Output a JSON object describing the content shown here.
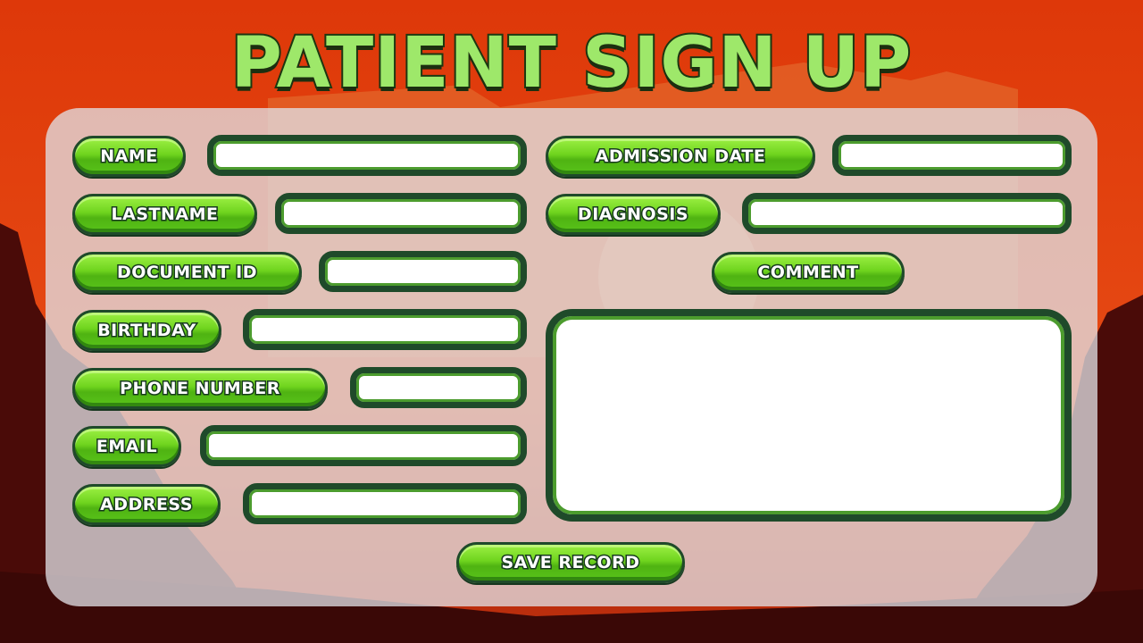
{
  "title": "PATIENT SIGN UP",
  "colors": {
    "sky": "#dd3a0c",
    "panel": "#e1e1e6",
    "button_green": "#6fd41e",
    "button_border": "#1f4a2a",
    "title_green": "#9ee86a"
  },
  "form": {
    "left_fields": [
      {
        "label": "NAME",
        "value": "",
        "placeholder": ""
      },
      {
        "label": "LASTNAME",
        "value": "",
        "placeholder": ""
      },
      {
        "label": "DOCUMENT ID",
        "value": "",
        "placeholder": ""
      },
      {
        "label": "BIRTHDAY",
        "value": "",
        "placeholder": ""
      },
      {
        "label": "PHONE NUMBER",
        "value": "",
        "placeholder": ""
      },
      {
        "label": "EMAIL",
        "value": "",
        "placeholder": ""
      },
      {
        "label": "ADDRESS",
        "value": "",
        "placeholder": ""
      }
    ],
    "right_fields": [
      {
        "label": "ADMISSION DATE",
        "value": "",
        "placeholder": ""
      },
      {
        "label": "DIAGNOSIS",
        "value": "",
        "placeholder": ""
      }
    ],
    "comment": {
      "label": "COMMENT",
      "value": "",
      "placeholder": ""
    }
  },
  "save_label": "SAVE RECORD"
}
